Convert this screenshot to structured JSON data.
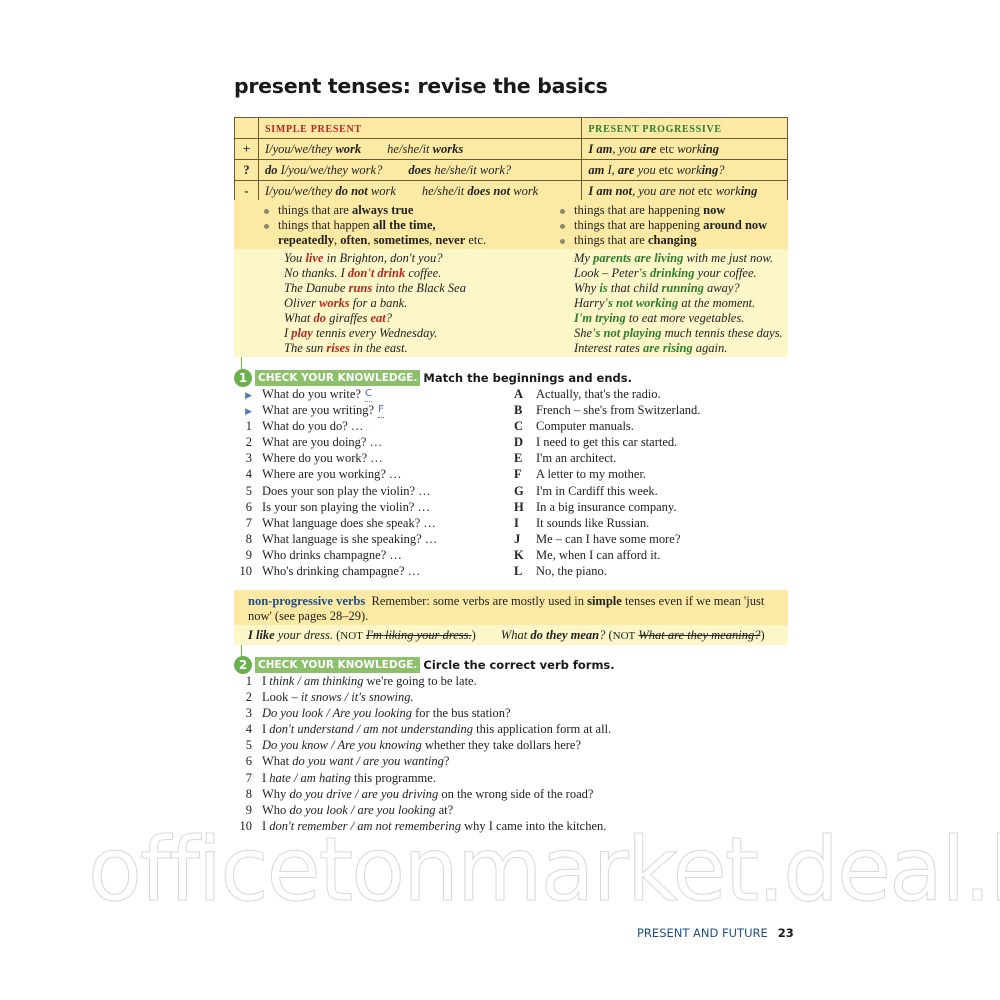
{
  "title": "present tenses: revise the basics",
  "table": {
    "headers": {
      "simple": "SIMPLE PRESENT",
      "progressive": "PRESENT PROGRESSIVE"
    },
    "rows": [
      {
        "symbol": "+",
        "simple_a_pre": "I/you/we/they ",
        "simple_a_bold": "work",
        "simple_b_pre": "he/she/it ",
        "simple_b_bold": "works",
        "prog_html": "<b>I am</b>, you <b>are</b> <span style='font-style:normal'>etc</span> work<b>ing</b>"
      },
      {
        "symbol": "?",
        "simple_a_bold": "do",
        "simple_a_pre": " I/you/we/they work?",
        "simple_b_bold": "does",
        "simple_b_pre": " he/she/it work?",
        "prog_html": "<b>am</b> I, <b>are</b> you <span style='font-style:normal'>etc</span> work<b>ing</b>?"
      },
      {
        "symbol": "-",
        "simple_a_pre": "I/you/we/they ",
        "simple_a_bold": "do not",
        "simple_a_post": " work",
        "simple_b_pre": "he/she/it ",
        "simple_b_bold": "does not",
        "simple_b_post": " work",
        "prog_html": "<b>I am not</b>, you are not <span style='font-style:normal'>etc</span> work<b>ing</b>"
      }
    ]
  },
  "uses": {
    "simple": [
      "things that are <b>always true</b>",
      "things that happen <b>all the time,</b><br><b>repeatedly</b>, <b>often</b>, <b>sometimes</b>, <b>never</b> etc."
    ],
    "progressive": [
      "things that are happening <b>now</b>",
      "things that are happening <b>around now</b>",
      "things that are <b>changing</b>"
    ]
  },
  "examples": {
    "simple": [
      "You <span class='red'>live</span> in Brighton, don't you?",
      "No thanks. I <span class='red'>don't drink</span> coffee.",
      "The Danube <span class='red'>runs</span> into the Black Sea",
      "Oliver <span class='red'>works</span> for a bank.",
      "What <span class='red'>do</span> giraffes <span class='red'>eat</span>?",
      "I <span class='red'>play</span> tennis every Wednesday.",
      "The sun <span class='red'>rises</span> in the east."
    ],
    "progressive": [
      "My <span class='grn'>parents are living</span> with me just now.",
      "Look – Peter<span class='grn'>'s drinking</span> your coffee.",
      "Why <span class='grn'>is</span> that child <span class='grn'>running</span> away?",
      "Harry<span class='grn'>'s not working</span> at the moment.",
      "<span class='grn'>I'm trying</span> to eat more vegetables.",
      "She<span class='grn'>'s not playing</span> much tennis these days.",
      "Interest rates <span class='grn'>are rising</span> again."
    ]
  },
  "exercise1": {
    "number": "1",
    "tag": "CHECK YOUR KNOWLEDGE.",
    "instruction": "Match the beginnings and ends.",
    "examples": [
      {
        "text": "What do you write?",
        "answer": "C"
      },
      {
        "text": "What are you writing?",
        "answer": "F"
      }
    ],
    "items": [
      {
        "n": "1",
        "text": "What do you do?  …"
      },
      {
        "n": "2",
        "text": "What are you doing?  …"
      },
      {
        "n": "3",
        "text": "Where do you work?  …"
      },
      {
        "n": "4",
        "text": "Where are you working?  …"
      },
      {
        "n": "5",
        "text": "Does your son play the violin?  …"
      },
      {
        "n": "6",
        "text": "Is your son playing the violin?  …"
      },
      {
        "n": "7",
        "text": "What language does she speak?  …"
      },
      {
        "n": "8",
        "text": "What language is she speaking?  …"
      },
      {
        "n": "9",
        "text": "Who drinks champagne?  …"
      },
      {
        "n": "10",
        "text": "Who's drinking champagne?  …"
      }
    ],
    "endings": [
      {
        "letter": "A",
        "text": "Actually, that's the radio."
      },
      {
        "letter": "B",
        "text": "French – she's from Switzerland."
      },
      {
        "letter": "C",
        "text": "Computer manuals."
      },
      {
        "letter": "D",
        "text": "I need to get this car started."
      },
      {
        "letter": "E",
        "text": "I'm an architect."
      },
      {
        "letter": "F",
        "text": "A letter to my mother."
      },
      {
        "letter": "G",
        "text": "I'm in Cardiff this week."
      },
      {
        "letter": "H",
        "text": "In a big insurance company."
      },
      {
        "letter": "I",
        "text": "It sounds like Russian."
      },
      {
        "letter": "J",
        "text": "Me – can I have some more?"
      },
      {
        "letter": "K",
        "text": "Me, when I can afford it."
      },
      {
        "letter": "L",
        "text": "No, the piano."
      }
    ]
  },
  "note": {
    "title": "non-progressive verbs",
    "text_html": "Remember: some verbs are mostly used in <b>simple</b> tenses even if we mean 'just now' (see pages 28–29).",
    "examples_html": "<i><b>I like</b> your dress.</i> (<span class='sc'>NOT</span> <span class='strike'>I'm liking your dress.</span>)&nbsp;&nbsp;&nbsp;&nbsp;&nbsp;&nbsp;&nbsp; <i>What <b>do they mean</b>?</i> (<span class='sc'>NOT</span> <span class='strike'>What are they meaning?</span>)"
  },
  "exercise2": {
    "number": "2",
    "tag": "CHECK YOUR KNOWLEDGE.",
    "instruction": "Circle the correct verb forms.",
    "items": [
      {
        "n": "1",
        "html": "I <i>think / am thinking</i> we're going to be late."
      },
      {
        "n": "2",
        "html": "Look – <i>it snows / it's snowing.</i>"
      },
      {
        "n": "3",
        "html": "<i>Do you look / Are you looking</i> for the bus station?"
      },
      {
        "n": "4",
        "html": "I <i>don't understand / am not understanding</i> this application form at all."
      },
      {
        "n": "5",
        "html": "<i>Do you know / Are you knowing</i> whether they take dollars here?"
      },
      {
        "n": "6",
        "html": "What <i>do you want / are you wanting</i>?"
      },
      {
        "n": "7",
        "html": "I <i>hate / am hating</i> this programme."
      },
      {
        "n": "8",
        "html": "Why <i>do you drive / are you driving</i> on the wrong side of the road?"
      },
      {
        "n": "9",
        "html": "Who <i>do you look / are you looking</i> at?"
      },
      {
        "n": "10",
        "html": "I <i>don't remember / am not remembering</i> why I came into the kitchen."
      }
    ]
  },
  "footer": {
    "section": "PRESENT AND FUTURE",
    "page": "23"
  },
  "watermark": "officetonmarket.deal.by"
}
